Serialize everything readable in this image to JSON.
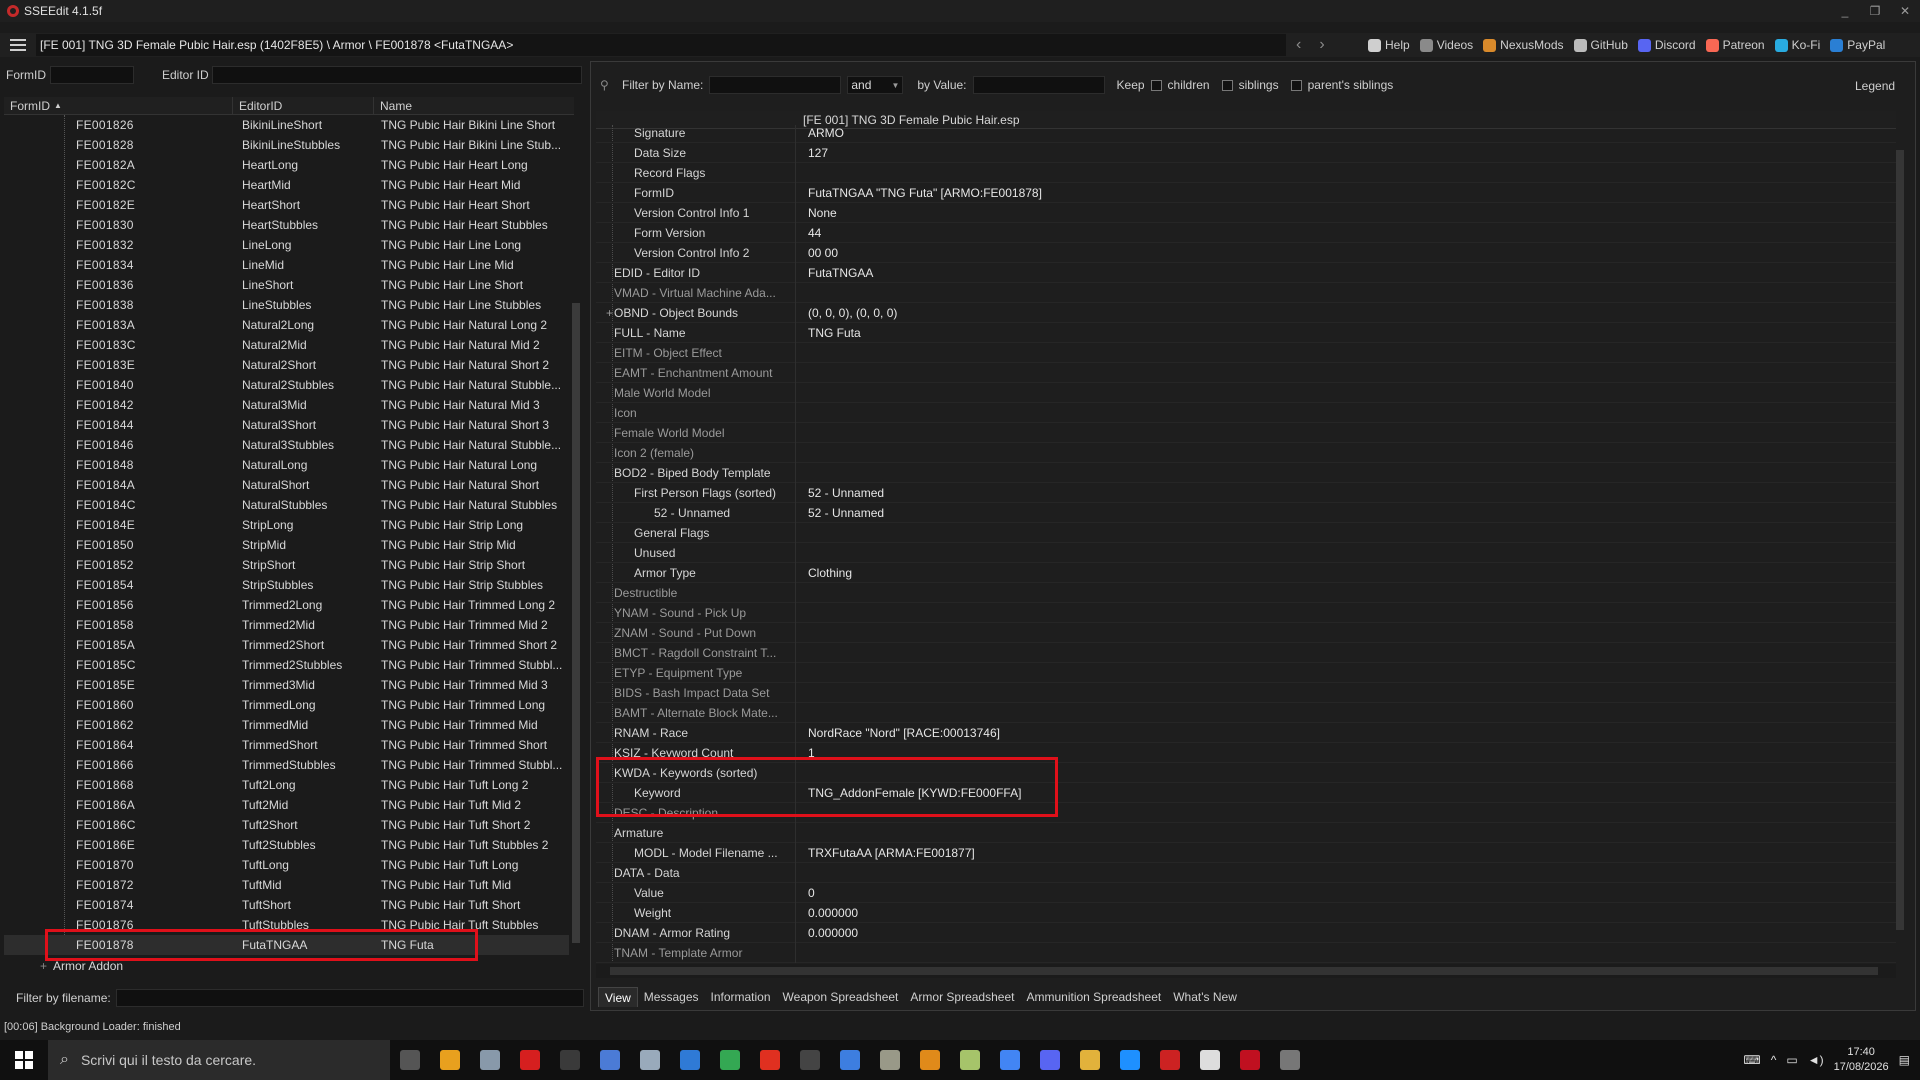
{
  "window": {
    "title": "SSEEdit 4.1.5f",
    "controls": [
      "_",
      "❐",
      "✕"
    ]
  },
  "pathbar": {
    "path": "[FE 001] TNG 3D Female Pubic Hair.esp (1402F8E5) \\ Armor \\ FE001878 <FutaTNGAA>",
    "links": [
      {
        "label": "Help",
        "color": "#cfcfcf"
      },
      {
        "label": "Videos",
        "color": "#8a8a8a"
      },
      {
        "label": "NexusMods",
        "color": "#d98a2b"
      },
      {
        "label": "GitHub",
        "color": "#bbbbbb"
      },
      {
        "label": "Discord",
        "color": "#5865f2"
      },
      {
        "label": "Patreon",
        "color": "#f96854"
      },
      {
        "label": "Ko-Fi",
        "color": "#29abe0"
      },
      {
        "label": "PayPal",
        "color": "#2a7fd4"
      }
    ]
  },
  "left_filter": {
    "formid_label": "FormID",
    "editorid_label": "Editor ID"
  },
  "left_grid": {
    "headers": [
      "FormID",
      "EditorID",
      "Name"
    ],
    "rows": [
      [
        "FE001826",
        "BikiniLineShort",
        "TNG Pubic Hair Bikini Line Short"
      ],
      [
        "FE001828",
        "BikiniLineStubbles",
        "TNG Pubic Hair Bikini Line Stub..."
      ],
      [
        "FE00182A",
        "HeartLong",
        "TNG Pubic Hair Heart Long"
      ],
      [
        "FE00182C",
        "HeartMid",
        "TNG Pubic Hair Heart Mid"
      ],
      [
        "FE00182E",
        "HeartShort",
        "TNG Pubic Hair Heart Short"
      ],
      [
        "FE001830",
        "HeartStubbles",
        "TNG Pubic Hair Heart Stubbles"
      ],
      [
        "FE001832",
        "LineLong",
        "TNG Pubic Hair Line Long"
      ],
      [
        "FE001834",
        "LineMid",
        "TNG Pubic Hair Line Mid"
      ],
      [
        "FE001836",
        "LineShort",
        "TNG Pubic Hair Line Short"
      ],
      [
        "FE001838",
        "LineStubbles",
        "TNG Pubic Hair Line Stubbles"
      ],
      [
        "FE00183A",
        "Natural2Long",
        "TNG Pubic Hair Natural Long 2"
      ],
      [
        "FE00183C",
        "Natural2Mid",
        "TNG Pubic Hair Natural Mid 2"
      ],
      [
        "FE00183E",
        "Natural2Short",
        "TNG Pubic Hair Natural Short 2"
      ],
      [
        "FE001840",
        "Natural2Stubbles",
        "TNG Pubic Hair Natural Stubble..."
      ],
      [
        "FE001842",
        "Natural3Mid",
        "TNG Pubic Hair Natural Mid 3"
      ],
      [
        "FE001844",
        "Natural3Short",
        "TNG Pubic Hair Natural Short 3"
      ],
      [
        "FE001846",
        "Natural3Stubbles",
        "TNG Pubic Hair Natural Stubble..."
      ],
      [
        "FE001848",
        "NaturalLong",
        "TNG Pubic Hair Natural Long"
      ],
      [
        "FE00184A",
        "NaturalShort",
        "TNG Pubic Hair Natural Short"
      ],
      [
        "FE00184C",
        "NaturalStubbles",
        "TNG Pubic Hair Natural Stubbles"
      ],
      [
        "FE00184E",
        "StripLong",
        "TNG Pubic Hair Strip Long"
      ],
      [
        "FE001850",
        "StripMid",
        "TNG Pubic Hair Strip Mid"
      ],
      [
        "FE001852",
        "StripShort",
        "TNG Pubic Hair Strip Short"
      ],
      [
        "FE001854",
        "StripStubbles",
        "TNG Pubic Hair Strip Stubbles"
      ],
      [
        "FE001856",
        "Trimmed2Long",
        "TNG Pubic Hair Trimmed Long 2"
      ],
      [
        "FE001858",
        "Trimmed2Mid",
        "TNG Pubic Hair Trimmed Mid 2"
      ],
      [
        "FE00185A",
        "Trimmed2Short",
        "TNG Pubic Hair Trimmed Short 2"
      ],
      [
        "FE00185C",
        "Trimmed2Stubbles",
        "TNG Pubic Hair Trimmed Stubbl..."
      ],
      [
        "FE00185E",
        "Trimmed3Mid",
        "TNG Pubic Hair Trimmed Mid 3"
      ],
      [
        "FE001860",
        "TrimmedLong",
        "TNG Pubic Hair Trimmed Long"
      ],
      [
        "FE001862",
        "TrimmedMid",
        "TNG Pubic Hair Trimmed Mid"
      ],
      [
        "FE001864",
        "TrimmedShort",
        "TNG Pubic Hair Trimmed Short"
      ],
      [
        "FE001866",
        "TrimmedStubbles",
        "TNG Pubic Hair Trimmed Stubbl..."
      ],
      [
        "FE001868",
        "Tuft2Long",
        "TNG Pubic Hair Tuft Long 2"
      ],
      [
        "FE00186A",
        "Tuft2Mid",
        "TNG Pubic Hair Tuft Mid 2"
      ],
      [
        "FE00186C",
        "Tuft2Short",
        "TNG Pubic Hair Tuft Short 2"
      ],
      [
        "FE00186E",
        "Tuft2Stubbles",
        "TNG Pubic Hair Tuft Stubbles 2"
      ],
      [
        "FE001870",
        "TuftLong",
        "TNG Pubic Hair Tuft Long"
      ],
      [
        "FE001872",
        "TuftMid",
        "TNG Pubic Hair Tuft Mid"
      ],
      [
        "FE001874",
        "TuftShort",
        "TNG Pubic Hair Tuft Short"
      ],
      [
        "FE001876",
        "TuftStubbles",
        "TNG Pubic Hair Tuft Stubbles"
      ],
      [
        "FE001878",
        "FutaTNGAA",
        "TNG Futa"
      ]
    ],
    "group_label": "Armor Addon"
  },
  "left_filename": {
    "label": "Filter by filename:"
  },
  "right_filter": {
    "name_label": "Filter by Name:",
    "op": "and",
    "value_label": "by Value:",
    "keep_label": "Keep",
    "children_label": "children",
    "siblings_label": "siblings",
    "parents_label": "parent's siblings",
    "legend_label": "Legend"
  },
  "right_grid": {
    "header": "[FE 001] TNG 3D Female Pubic Hair.esp",
    "rows": [
      {
        "k": "Signature",
        "v": "ARMO",
        "lvl": 1
      },
      {
        "k": "Data Size",
        "v": "127",
        "lvl": 1
      },
      {
        "k": "Record Flags",
        "v": "",
        "lvl": 1
      },
      {
        "k": "FormID",
        "v": "FutaTNGAA \"TNG Futa\" [ARMO:FE001878]",
        "lvl": 1
      },
      {
        "k": "Version Control Info 1",
        "v": "None",
        "lvl": 1
      },
      {
        "k": "Form Version",
        "v": "44",
        "lvl": 1
      },
      {
        "k": "Version Control Info 2",
        "v": "00 00",
        "lvl": 1
      },
      {
        "k": "EDID - Editor ID",
        "v": "FutaTNGAA",
        "lvl": 0
      },
      {
        "k": "VMAD - Virtual Machine Ada...",
        "v": "",
        "lvl": 0,
        "dim": true
      },
      {
        "k": "OBND - Object Bounds",
        "v": "(0, 0, 0), (0, 0, 0)",
        "lvl": 0,
        "plus": true
      },
      {
        "k": "FULL - Name",
        "v": "TNG Futa",
        "lvl": 0
      },
      {
        "k": "EITM - Object Effect",
        "v": "",
        "lvl": 0,
        "dim": true
      },
      {
        "k": "EAMT - Enchantment Amount",
        "v": "",
        "lvl": 0,
        "dim": true
      },
      {
        "k": "Male World Model",
        "v": "",
        "lvl": 0,
        "dim": true
      },
      {
        "k": "Icon",
        "v": "",
        "lvl": 0,
        "dim": true
      },
      {
        "k": "Female World Model",
        "v": "",
        "lvl": 0,
        "dim": true
      },
      {
        "k": "Icon 2 (female)",
        "v": "",
        "lvl": 0,
        "dim": true
      },
      {
        "k": "BOD2 - Biped Body Template",
        "v": "",
        "lvl": 0
      },
      {
        "k": "First Person Flags (sorted)",
        "v": "52 - Unnamed",
        "lvl": 1
      },
      {
        "k": "52 - Unnamed",
        "v": "52 - Unnamed",
        "lvl": 2
      },
      {
        "k": "General Flags",
        "v": "",
        "lvl": 1
      },
      {
        "k": "Unused",
        "v": "",
        "lvl": 1
      },
      {
        "k": "Armor Type",
        "v": "Clothing",
        "lvl": 1
      },
      {
        "k": "Destructible",
        "v": "",
        "lvl": 0,
        "dim": true
      },
      {
        "k": "YNAM - Sound - Pick Up",
        "v": "",
        "lvl": 0,
        "dim": true
      },
      {
        "k": "ZNAM - Sound - Put Down",
        "v": "",
        "lvl": 0,
        "dim": true
      },
      {
        "k": "BMCT - Ragdoll Constraint T...",
        "v": "",
        "lvl": 0,
        "dim": true
      },
      {
        "k": "ETYP - Equipment Type",
        "v": "",
        "lvl": 0,
        "dim": true
      },
      {
        "k": "BIDS - Bash Impact Data Set",
        "v": "",
        "lvl": 0,
        "dim": true
      },
      {
        "k": "BAMT - Alternate Block Mate...",
        "v": "",
        "lvl": 0,
        "dim": true
      },
      {
        "k": "RNAM - Race",
        "v": "NordRace \"Nord\" [RACE:00013746]",
        "lvl": 0
      },
      {
        "k": "KSIZ - Keyword Count",
        "v": "1",
        "lvl": 0
      },
      {
        "k": "KWDA - Keywords (sorted)",
        "v": "",
        "lvl": 0
      },
      {
        "k": "Keyword",
        "v": "TNG_AddonFemale [KYWD:FE000FFA]",
        "lvl": 1
      },
      {
        "k": "DESC - Description",
        "v": "",
        "lvl": 0,
        "dim": true
      },
      {
        "k": "Armature",
        "v": "",
        "lvl": 0
      },
      {
        "k": "MODL - Model Filename ...",
        "v": "TRXFutaAA [ARMA:FE001877]",
        "lvl": 1
      },
      {
        "k": "DATA - Data",
        "v": "",
        "lvl": 0
      },
      {
        "k": "Value",
        "v": "0",
        "lvl": 1
      },
      {
        "k": "Weight",
        "v": "0.000000",
        "lvl": 1
      },
      {
        "k": "DNAM - Armor Rating",
        "v": "0.000000",
        "lvl": 0
      },
      {
        "k": "TNAM - Template Armor",
        "v": "",
        "lvl": 0,
        "dim": true
      }
    ]
  },
  "tabs": [
    "View",
    "Messages",
    "Information",
    "Weapon Spreadsheet",
    "Armor Spreadsheet",
    "Ammunition Spreadsheet",
    "What's New"
  ],
  "status": "[00:06] Background Loader: finished",
  "taskbar": {
    "search_placeholder": "Scrivi qui il testo da cercare.",
    "time": "17:40",
    "date": "17/08/2026"
  },
  "colors": {
    "highlight": "#e0101a",
    "background": "#1b1b1b"
  }
}
